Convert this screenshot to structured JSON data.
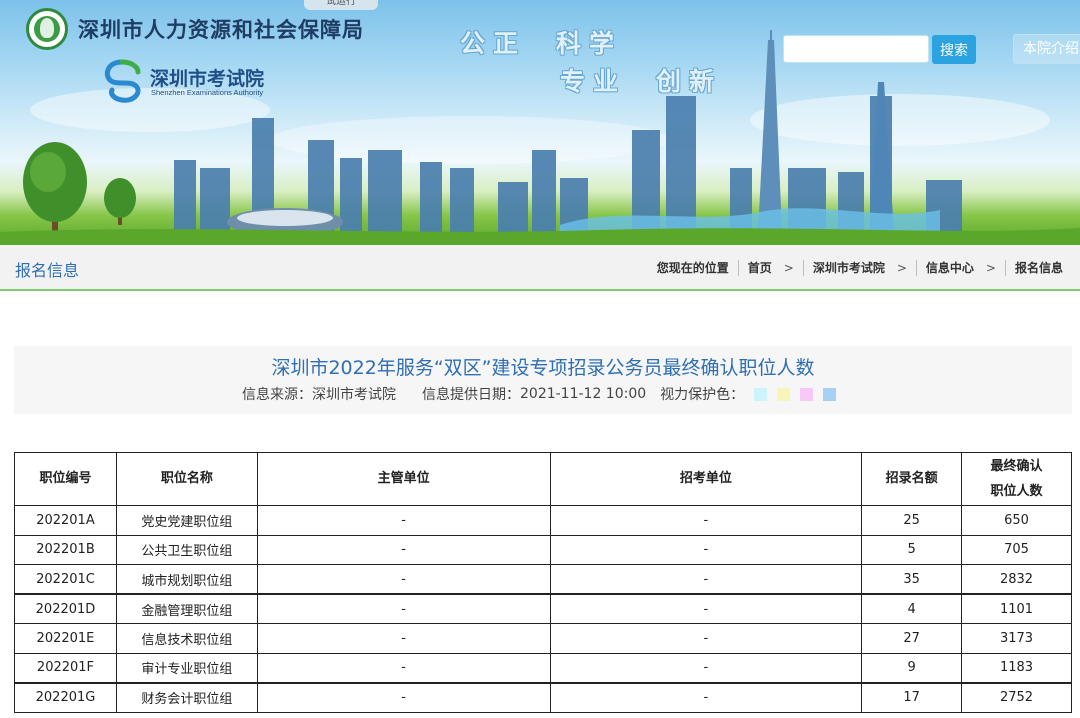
{
  "banner": {
    "trial_label": "试运行",
    "org_name": "深圳市人力资源和社会保障局",
    "exam_name": "深圳市考试院",
    "exam_name_en": "Shenzhen Examinations Authority",
    "motto": [
      "公正",
      "科学",
      "专业",
      "创新"
    ],
    "search": {
      "value": "",
      "button": "搜索"
    },
    "about_label": "本院介绍"
  },
  "breadcrumb_bar": {
    "section_title": "报名信息",
    "location_label": "您现在的位置",
    "items": [
      "首页",
      "深圳市考试院",
      "信息中心",
      "报名信息"
    ]
  },
  "article": {
    "title": "深圳市2022年服务“双区”建设专项招录公务员最终确认职位人数",
    "source_label": "信息来源：",
    "source": "深圳市考试院",
    "date_label": "信息提供日期：",
    "date": "2021-11-12 10:00",
    "eye_color_label": "视力保护色：",
    "eye_colors": [
      "#ccf5fb",
      "#f7f6b9",
      "#f8c8f6",
      "#a6d1f5"
    ]
  },
  "table": {
    "headers": [
      "职位编号",
      "职位名称",
      "主管单位",
      "招考单位",
      "招录名额",
      "最终确认",
      "职位人数"
    ],
    "rows": [
      [
        "202201A",
        "党史党建职位组",
        "-",
        "-",
        "25",
        "650"
      ],
      [
        "202201B",
        "公共卫生职位组",
        "-",
        "-",
        "5",
        "705"
      ],
      [
        "202201C",
        "城市规划职位组",
        "-",
        "-",
        "35",
        "2832"
      ],
      [
        "202201D",
        "金融管理职位组",
        "-",
        "-",
        "4",
        "1101"
      ],
      [
        "202201E",
        "信息技术职位组",
        "-",
        "-",
        "27",
        "3173"
      ],
      [
        "202201F",
        "审计专业职位组",
        "-",
        "-",
        "9",
        "1183"
      ],
      [
        "202201G",
        "财务会计职位组",
        "-",
        "-",
        "17",
        "2752"
      ]
    ]
  }
}
